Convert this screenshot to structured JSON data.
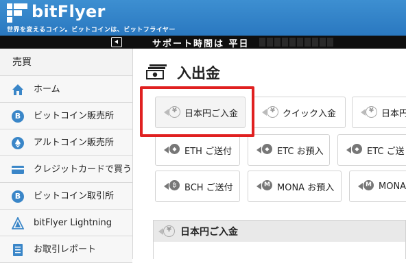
{
  "header": {
    "logo_text": "bitFlyer",
    "tagline": "世界を変えるコイン。ビットコインは、ビットフライヤー",
    "brand_color": "#2a78c0"
  },
  "ticker": {
    "text": "サポート時間は 平日"
  },
  "sidebar": {
    "heading": "売買",
    "items": [
      {
        "label": "ホーム",
        "icon": "home-icon"
      },
      {
        "label": "ビットコイン販売所",
        "icon": "bitcoin-icon"
      },
      {
        "label": "アルトコイン販売所",
        "icon": "ethereum-icon"
      },
      {
        "label": "クレジットカードで買う",
        "icon": "credit-card-icon"
      },
      {
        "label": "ビットコイン取引所",
        "icon": "bitcoin-icon"
      },
      {
        "label": "bitFlyer Lightning",
        "icon": "lightning-icon"
      },
      {
        "label": "お取引レポート",
        "icon": "report-icon"
      }
    ]
  },
  "main": {
    "title": "入出金",
    "buttons_row1": [
      {
        "label": "日本円ご入金",
        "icon": "yen-deposit-icon"
      },
      {
        "label": "クイック入金",
        "icon": "quick-deposit-icon"
      },
      {
        "label": "日本円",
        "icon": "yen-withdraw-icon"
      }
    ],
    "buttons_row2": [
      {
        "label": "ETH ご送付",
        "icon": "eth-send-icon"
      },
      {
        "label": "ETC お預入",
        "icon": "etc-deposit-icon"
      },
      {
        "label": "ETC ご送",
        "icon": "etc-send-icon"
      }
    ],
    "buttons_row3": [
      {
        "label": "BCH ご送付",
        "icon": "bch-send-icon"
      },
      {
        "label": "MONA お預入",
        "icon": "mona-deposit-icon"
      },
      {
        "label": "MONA",
        "icon": "mona-send-icon"
      }
    ],
    "panel_title": "日本円ご入金",
    "highlight_color": "#e02020"
  }
}
